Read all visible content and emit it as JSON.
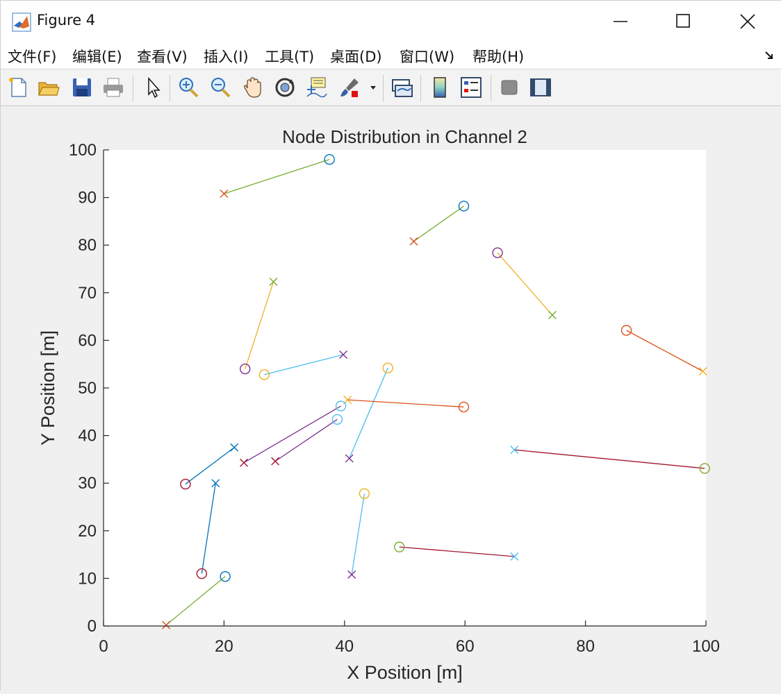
{
  "window": {
    "title": "Figure 4"
  },
  "menu": [
    {
      "label": "文件(F)"
    },
    {
      "label": "编辑(E)"
    },
    {
      "label": "查看(V)"
    },
    {
      "label": "插入(I)"
    },
    {
      "label": "工具(T)"
    },
    {
      "label": "桌面(D)"
    },
    {
      "label": "窗口(W)"
    },
    {
      "label": "帮助(H)"
    }
  ],
  "toolbar": [
    {
      "icon": "new-figure-icon"
    },
    {
      "icon": "open-file-icon"
    },
    {
      "icon": "save-icon"
    },
    {
      "icon": "print-icon"
    },
    {
      "icon": "select-arrow-icon"
    },
    {
      "icon": "zoom-in-icon"
    },
    {
      "icon": "zoom-out-icon"
    },
    {
      "icon": "pan-hand-icon"
    },
    {
      "icon": "rotate-3d-icon"
    },
    {
      "icon": "data-cursor-icon"
    },
    {
      "icon": "brush-icon"
    },
    {
      "icon": "link-plot-icon"
    },
    {
      "icon": "colorbar-icon"
    },
    {
      "icon": "legend-icon"
    },
    {
      "icon": "hide-plot-tools-icon"
    },
    {
      "icon": "show-plot-tools-icon"
    }
  ],
  "chart_data": {
    "type": "scatter",
    "title": "Node Distribution in Channel 2",
    "xlabel": "X Position [m]",
    "ylabel": "Y Position [m]",
    "xlim": [
      0,
      100
    ],
    "ylim": [
      0,
      100
    ],
    "xticks": [
      0,
      20,
      40,
      60,
      80,
      100
    ],
    "yticks": [
      0,
      10,
      20,
      30,
      40,
      50,
      60,
      70,
      80,
      90,
      100
    ],
    "grid": false,
    "legend": "none",
    "pairs": [
      {
        "o": [
          37.5,
          98.0
        ],
        "x": [
          20.0,
          90.8
        ],
        "o_color": "#0072BD",
        "x_color": "#D95319",
        "line_color": "#77AC30"
      },
      {
        "o": [
          59.8,
          88.2
        ],
        "x": [
          51.5,
          80.8
        ],
        "o_color": "#0072BD",
        "x_color": "#D95319",
        "line_color": "#77AC30"
      },
      {
        "o": [
          65.4,
          78.4
        ],
        "x": [
          74.5,
          65.3
        ],
        "o_color": "#7E2F8E",
        "x_color": "#77AC30",
        "line_color": "#EDB120"
      },
      {
        "o": [
          23.5,
          54.0
        ],
        "x": [
          28.2,
          72.3
        ],
        "o_color": "#7E2F8E",
        "x_color": "#77AC30",
        "line_color": "#EDB120"
      },
      {
        "o": [
          26.7,
          52.8
        ],
        "x": [
          39.8,
          57.0
        ],
        "o_color": "#EDB120",
        "x_color": "#7E2F8E",
        "line_color": "#4DBEEE"
      },
      {
        "o": [
          47.2,
          54.2
        ],
        "x": [
          40.8,
          35.2
        ],
        "o_color": "#EDB120",
        "x_color": "#7E2F8E",
        "line_color": "#4DBEEE"
      },
      {
        "o": [
          43.3,
          27.8
        ],
        "x": [
          41.2,
          10.8
        ],
        "o_color": "#EDB120",
        "x_color": "#7E2F8E",
        "line_color": "#4DBEEE"
      },
      {
        "o": [
          86.8,
          62.1
        ],
        "x": [
          99.5,
          53.5
        ],
        "o_color": "#D95319",
        "x_color": "#EDB120",
        "line_color": "#D95319"
      },
      {
        "o": [
          59.8,
          46.0
        ],
        "x": [
          40.5,
          47.5
        ],
        "o_color": "#D95319",
        "x_color": "#EDB120",
        "line_color": "#D95319"
      },
      {
        "o": [
          39.4,
          46.2
        ],
        "x": [
          23.3,
          34.3
        ],
        "o_color": "#4DBEEE",
        "x_color": "#A2142F",
        "line_color": "#7E2F8E"
      },
      {
        "o": [
          38.8,
          43.4
        ],
        "x": [
          28.5,
          34.6
        ],
        "o_color": "#4DBEEE",
        "x_color": "#A2142F",
        "line_color": "#7E2F8E"
      },
      {
        "o": [
          99.8,
          33.1
        ],
        "x": [
          68.2,
          37.0
        ],
        "o_color": "#77AC30",
        "x_color": "#4DBEEE",
        "line_color": "#A2142F"
      },
      {
        "o": [
          49.1,
          16.6
        ],
        "x": [
          68.2,
          14.6
        ],
        "o_color": "#77AC30",
        "x_color": "#4DBEEE",
        "line_color": "#A2142F"
      },
      {
        "o": [
          13.6,
          29.8
        ],
        "x": [
          21.7,
          37.5
        ],
        "o_color": "#A2142F",
        "x_color": "#0072BD",
        "line_color": "#0072BD"
      },
      {
        "o": [
          16.3,
          11.0
        ],
        "x": [
          18.6,
          30.0
        ],
        "o_color": "#A2142F",
        "x_color": "#0072BD",
        "line_color": "#0072BD"
      },
      {
        "o": [
          20.2,
          10.4
        ],
        "x": [
          10.4,
          0.2
        ],
        "o_color": "#0072BD",
        "x_color": "#D95319",
        "line_color": "#77AC30"
      }
    ]
  }
}
